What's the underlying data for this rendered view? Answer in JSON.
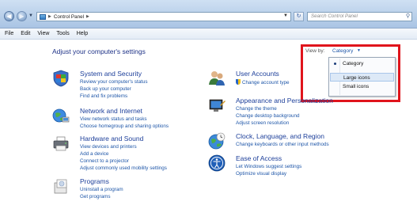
{
  "window": {
    "address_crumb": "Control Panel",
    "search_placeholder": "Search Control Panel"
  },
  "menu": [
    "File",
    "Edit",
    "View",
    "Tools",
    "Help"
  ],
  "main": {
    "page_title": "Adjust your computer's settings",
    "view_by_label": "View by:",
    "view_by_value": "Category",
    "view_options": [
      "Category",
      "Large icons",
      "Small icons"
    ],
    "selected_option": "Category",
    "hovered_option": "Large icons"
  },
  "categories_left": [
    {
      "title": "System and Security",
      "icon": "shield-flag-icon",
      "links": [
        "Review your computer's status",
        "Back up your computer",
        "Find and fix problems"
      ]
    },
    {
      "title": "Network and Internet",
      "icon": "network-globe-icon",
      "links": [
        "View network status and tasks",
        "Choose homegroup and sharing options"
      ]
    },
    {
      "title": "Hardware and Sound",
      "icon": "printer-icon",
      "links": [
        "View devices and printers",
        "Add a device",
        "Connect to a projector",
        "Adjust commonly used mobility settings"
      ]
    },
    {
      "title": "Programs",
      "icon": "programs-box-icon",
      "links": [
        "Uninstall a program",
        "Get programs"
      ]
    }
  ],
  "categories_right": [
    {
      "title": "User Accounts",
      "icon": "users-icon",
      "links": [
        "Change account type"
      ]
    },
    {
      "title": "Appearance and Personalization",
      "icon": "appearance-monitor-icon",
      "links": [
        "Change the theme",
        "Change desktop background",
        "Adjust screen resolution"
      ]
    },
    {
      "title": "Clock, Language, and Region",
      "icon": "clock-globe-icon",
      "links": [
        "Change keyboards or other input methods"
      ]
    },
    {
      "title": "Ease of Access",
      "icon": "ease-of-access-icon",
      "links": [
        "Let Windows suggest settings",
        "Optimize visual display"
      ]
    }
  ]
}
